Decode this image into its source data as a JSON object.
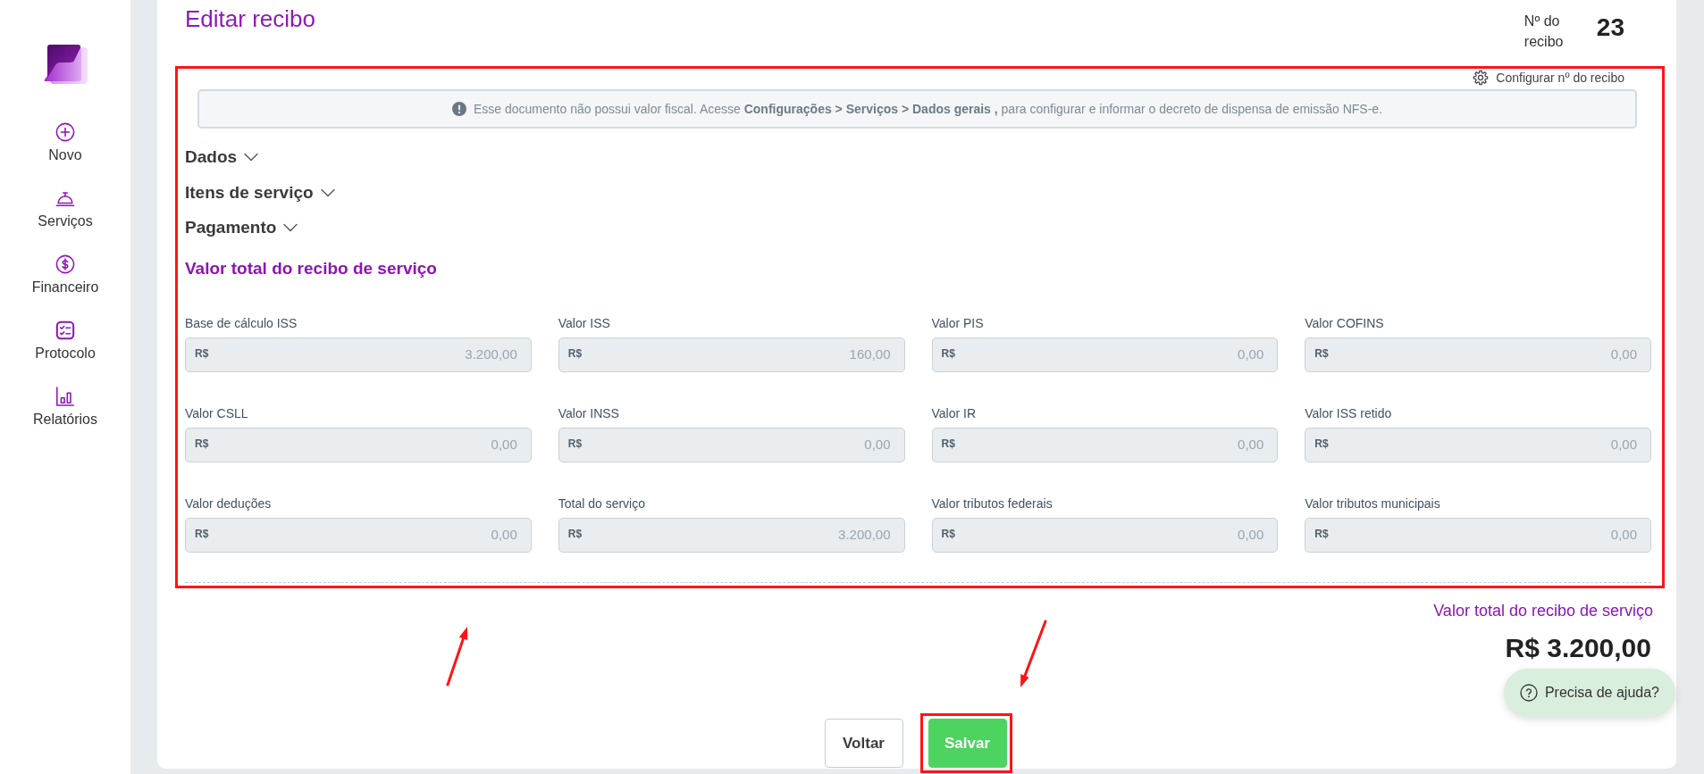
{
  "sidebar": {
    "items": [
      {
        "label": "Novo"
      },
      {
        "label": "Serviços"
      },
      {
        "label": "Financeiro"
      },
      {
        "label": "Protocolo"
      },
      {
        "label": "Relatórios"
      }
    ]
  },
  "header": {
    "title": "Editar recibo",
    "receipt_number_label": "Nº do recibo",
    "receipt_number": "23"
  },
  "form": {
    "highlighted": true,
    "config_link": "Configurar nº do recibo",
    "notice": "Esse documento não possui valor fiscal. Acesse **Configurações > Serviços > Dados gerais ,** para configurar e informar o decreto de dispensa de emissão NFS-e.",
    "sections": [
      {
        "label": "Dados",
        "expanded": false
      },
      {
        "label": "Itens de serviço",
        "expanded": false
      },
      {
        "label": "Pagamento",
        "expanded": false
      }
    ],
    "totals_title": "Valor total do recibo de serviço",
    "fields": [
      {
        "label": "Base de cálculo ISS",
        "prefix": "R$",
        "value": "3.200,00",
        "disabled": true
      },
      {
        "label": "Valor ISS",
        "prefix": "R$",
        "value": "160,00",
        "disabled": true
      },
      {
        "label": "Valor PIS",
        "prefix": "R$",
        "value": "0,00",
        "disabled": true
      },
      {
        "label": "Valor COFINS",
        "prefix": "R$",
        "value": "0,00",
        "disabled": true
      },
      {
        "label": "Valor CSLL",
        "prefix": "R$",
        "value": "0,00",
        "disabled": true
      },
      {
        "label": "Valor INSS",
        "prefix": "R$",
        "value": "0,00",
        "disabled": true
      },
      {
        "label": "Valor IR",
        "prefix": "R$",
        "value": "0,00",
        "disabled": true
      },
      {
        "label": "Valor ISS retido",
        "prefix": "R$",
        "value": "0,00",
        "disabled": true
      },
      {
        "label": "Valor deduções",
        "prefix": "R$",
        "value": "0,00",
        "disabled": true
      },
      {
        "label": "Total do serviço",
        "prefix": "R$",
        "value": "3.200,00",
        "disabled": true
      },
      {
        "label": "Valor tributos federais",
        "prefix": "R$",
        "value": "0,00",
        "disabled": true
      },
      {
        "label": "Valor tributos municipais",
        "prefix": "R$",
        "value": "0,00",
        "disabled": true
      }
    ]
  },
  "summary": {
    "label": "Valor total do recibo de serviço",
    "value": "R$ 3.200,00"
  },
  "buttons": [
    {
      "label": "Voltar",
      "kind": "secondary",
      "highlighted": false
    },
    {
      "label": "Salvar",
      "kind": "primary",
      "highlighted": true
    }
  ],
  "help_button": {
    "label": "Precisa de ajuda?"
  },
  "annotations": [
    {
      "kind": "arrow_up"
    },
    {
      "kind": "arrow_down"
    }
  ]
}
